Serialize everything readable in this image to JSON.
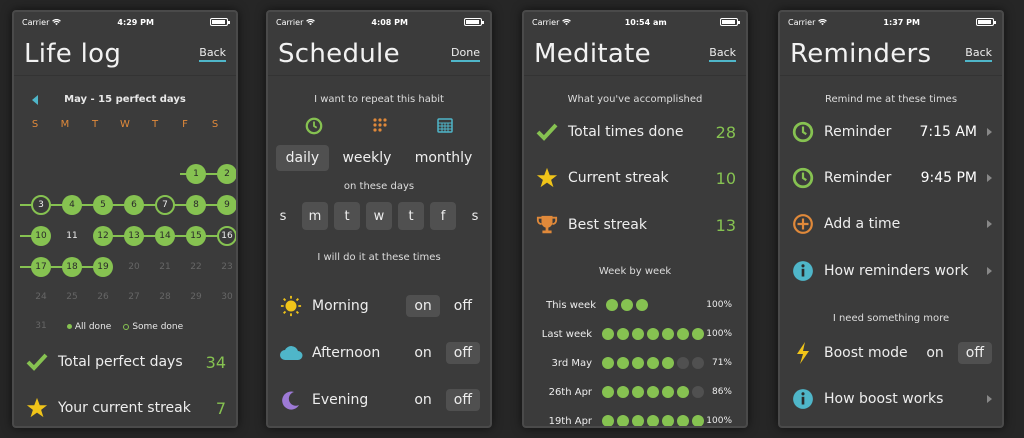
{
  "colors": {
    "accent": "#86c251",
    "link": "#4fb6c9",
    "weekday": "#e0893a",
    "star": "#f0c419",
    "trophy": "#e0893a",
    "background": "#3b3b3b"
  },
  "status": {
    "carrier": "Carrier"
  },
  "lifelog": {
    "time": "4:29 PM",
    "title": "Life log",
    "back": "Back",
    "month_label": "May - 15 perfect days",
    "weekdays": [
      "S",
      "M",
      "T",
      "W",
      "T",
      "F",
      "S"
    ],
    "legend_all": "All done",
    "legend_some": "Some done",
    "stats": [
      {
        "icon": "check-icon",
        "label": "Total perfect days",
        "value": "34"
      },
      {
        "icon": "star-icon",
        "label": "Your current streak",
        "value": "7"
      }
    ]
  },
  "schedule": {
    "time": "4:08 PM",
    "title": "Schedule",
    "done": "Done",
    "repeat_label": "I want to repeat this habit",
    "frequencies": [
      {
        "label": "daily",
        "icon": "clock-icon",
        "active": true
      },
      {
        "label": "weekly",
        "icon": "dots-grid-icon",
        "active": false
      },
      {
        "label": "monthly",
        "icon": "calendar-icon",
        "active": false
      }
    ],
    "days_label": "on these days",
    "days": [
      {
        "label": "s",
        "active": false
      },
      {
        "label": "m",
        "active": true
      },
      {
        "label": "t",
        "active": true
      },
      {
        "label": "w",
        "active": true
      },
      {
        "label": "t",
        "active": true
      },
      {
        "label": "f",
        "active": true
      },
      {
        "label": "s",
        "active": false
      }
    ],
    "times_label": "I will do it at these times",
    "times": [
      {
        "label": "Morning",
        "icon": "sun-icon",
        "on": "on",
        "off": "off",
        "state": "on"
      },
      {
        "label": "Afternoon",
        "icon": "cloud-icon",
        "on": "on",
        "off": "off",
        "state": "off"
      },
      {
        "label": "Evening",
        "icon": "moon-icon",
        "on": "on",
        "off": "off",
        "state": "off"
      }
    ]
  },
  "meditate": {
    "time": "10:54 am",
    "title": "Meditate",
    "back": "Back",
    "accomplished_label": "What you've accomplished",
    "stats": [
      {
        "icon": "check-icon",
        "label": "Total times done",
        "value": "28"
      },
      {
        "icon": "star-icon",
        "label": "Current streak",
        "value": "10"
      },
      {
        "icon": "trophy-icon",
        "label": "Best streak",
        "value": "13"
      }
    ],
    "week_label": "Week by week",
    "weeks": [
      {
        "label": "This week",
        "done": 3,
        "total": 3,
        "pct": "100%"
      },
      {
        "label": "Last week",
        "done": 7,
        "total": 7,
        "pct": "100%"
      },
      {
        "label": "3rd May",
        "done": 5,
        "total": 7,
        "pct": "71%"
      },
      {
        "label": "26th Apr",
        "done": 6,
        "total": 7,
        "pct": "86%"
      },
      {
        "label": "19th Apr",
        "done": 7,
        "total": 7,
        "pct": "100%"
      }
    ]
  },
  "reminders": {
    "time": "1:37 PM",
    "title": "Reminders",
    "back": "Back",
    "remind_label": "Remind me at these times",
    "items": [
      {
        "icon": "clock-icon",
        "label": "Reminder",
        "time": "7:15 AM"
      },
      {
        "icon": "clock-icon",
        "label": "Reminder",
        "time": "9:45 PM"
      },
      {
        "icon": "plus-circle-icon",
        "label": "Add a time",
        "time": ""
      },
      {
        "icon": "info-icon",
        "label": "How reminders work",
        "time": ""
      }
    ],
    "more_label": "I need something more",
    "boost": {
      "icon": "bolt-icon",
      "label": "Boost mode",
      "on": "on",
      "off": "off",
      "state": "off"
    },
    "boost_info": {
      "icon": "info-icon",
      "label": "How boost works"
    }
  }
}
